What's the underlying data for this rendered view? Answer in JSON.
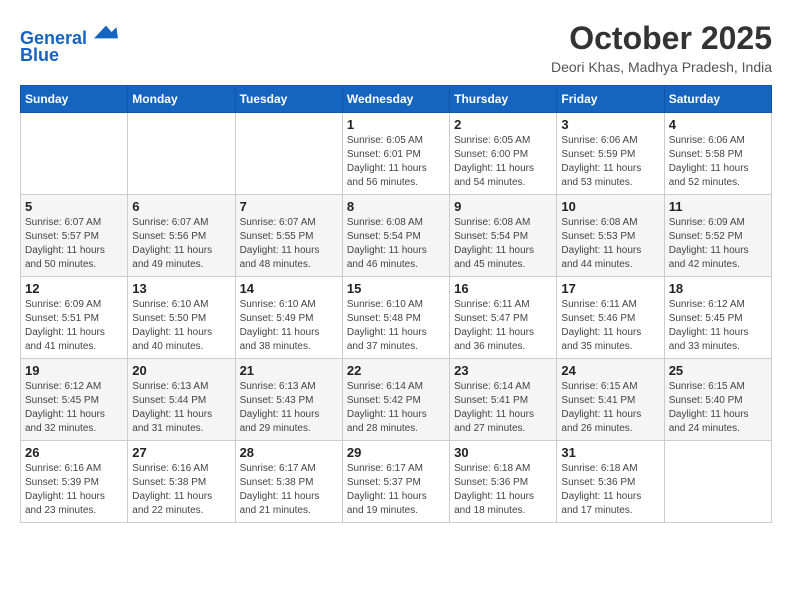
{
  "header": {
    "logo_line1": "General",
    "logo_line2": "Blue",
    "month": "October 2025",
    "location": "Deori Khas, Madhya Pradesh, India"
  },
  "weekdays": [
    "Sunday",
    "Monday",
    "Tuesday",
    "Wednesday",
    "Thursday",
    "Friday",
    "Saturday"
  ],
  "weeks": [
    [
      {
        "day": "",
        "info": ""
      },
      {
        "day": "",
        "info": ""
      },
      {
        "day": "",
        "info": ""
      },
      {
        "day": "1",
        "info": "Sunrise: 6:05 AM\nSunset: 6:01 PM\nDaylight: 11 hours\nand 56 minutes."
      },
      {
        "day": "2",
        "info": "Sunrise: 6:05 AM\nSunset: 6:00 PM\nDaylight: 11 hours\nand 54 minutes."
      },
      {
        "day": "3",
        "info": "Sunrise: 6:06 AM\nSunset: 5:59 PM\nDaylight: 11 hours\nand 53 minutes."
      },
      {
        "day": "4",
        "info": "Sunrise: 6:06 AM\nSunset: 5:58 PM\nDaylight: 11 hours\nand 52 minutes."
      }
    ],
    [
      {
        "day": "5",
        "info": "Sunrise: 6:07 AM\nSunset: 5:57 PM\nDaylight: 11 hours\nand 50 minutes."
      },
      {
        "day": "6",
        "info": "Sunrise: 6:07 AM\nSunset: 5:56 PM\nDaylight: 11 hours\nand 49 minutes."
      },
      {
        "day": "7",
        "info": "Sunrise: 6:07 AM\nSunset: 5:55 PM\nDaylight: 11 hours\nand 48 minutes."
      },
      {
        "day": "8",
        "info": "Sunrise: 6:08 AM\nSunset: 5:54 PM\nDaylight: 11 hours\nand 46 minutes."
      },
      {
        "day": "9",
        "info": "Sunrise: 6:08 AM\nSunset: 5:54 PM\nDaylight: 11 hours\nand 45 minutes."
      },
      {
        "day": "10",
        "info": "Sunrise: 6:08 AM\nSunset: 5:53 PM\nDaylight: 11 hours\nand 44 minutes."
      },
      {
        "day": "11",
        "info": "Sunrise: 6:09 AM\nSunset: 5:52 PM\nDaylight: 11 hours\nand 42 minutes."
      }
    ],
    [
      {
        "day": "12",
        "info": "Sunrise: 6:09 AM\nSunset: 5:51 PM\nDaylight: 11 hours\nand 41 minutes."
      },
      {
        "day": "13",
        "info": "Sunrise: 6:10 AM\nSunset: 5:50 PM\nDaylight: 11 hours\nand 40 minutes."
      },
      {
        "day": "14",
        "info": "Sunrise: 6:10 AM\nSunset: 5:49 PM\nDaylight: 11 hours\nand 38 minutes."
      },
      {
        "day": "15",
        "info": "Sunrise: 6:10 AM\nSunset: 5:48 PM\nDaylight: 11 hours\nand 37 minutes."
      },
      {
        "day": "16",
        "info": "Sunrise: 6:11 AM\nSunset: 5:47 PM\nDaylight: 11 hours\nand 36 minutes."
      },
      {
        "day": "17",
        "info": "Sunrise: 6:11 AM\nSunset: 5:46 PM\nDaylight: 11 hours\nand 35 minutes."
      },
      {
        "day": "18",
        "info": "Sunrise: 6:12 AM\nSunset: 5:45 PM\nDaylight: 11 hours\nand 33 minutes."
      }
    ],
    [
      {
        "day": "19",
        "info": "Sunrise: 6:12 AM\nSunset: 5:45 PM\nDaylight: 11 hours\nand 32 minutes."
      },
      {
        "day": "20",
        "info": "Sunrise: 6:13 AM\nSunset: 5:44 PM\nDaylight: 11 hours\nand 31 minutes."
      },
      {
        "day": "21",
        "info": "Sunrise: 6:13 AM\nSunset: 5:43 PM\nDaylight: 11 hours\nand 29 minutes."
      },
      {
        "day": "22",
        "info": "Sunrise: 6:14 AM\nSunset: 5:42 PM\nDaylight: 11 hours\nand 28 minutes."
      },
      {
        "day": "23",
        "info": "Sunrise: 6:14 AM\nSunset: 5:41 PM\nDaylight: 11 hours\nand 27 minutes."
      },
      {
        "day": "24",
        "info": "Sunrise: 6:15 AM\nSunset: 5:41 PM\nDaylight: 11 hours\nand 26 minutes."
      },
      {
        "day": "25",
        "info": "Sunrise: 6:15 AM\nSunset: 5:40 PM\nDaylight: 11 hours\nand 24 minutes."
      }
    ],
    [
      {
        "day": "26",
        "info": "Sunrise: 6:16 AM\nSunset: 5:39 PM\nDaylight: 11 hours\nand 23 minutes."
      },
      {
        "day": "27",
        "info": "Sunrise: 6:16 AM\nSunset: 5:38 PM\nDaylight: 11 hours\nand 22 minutes."
      },
      {
        "day": "28",
        "info": "Sunrise: 6:17 AM\nSunset: 5:38 PM\nDaylight: 11 hours\nand 21 minutes."
      },
      {
        "day": "29",
        "info": "Sunrise: 6:17 AM\nSunset: 5:37 PM\nDaylight: 11 hours\nand 19 minutes."
      },
      {
        "day": "30",
        "info": "Sunrise: 6:18 AM\nSunset: 5:36 PM\nDaylight: 11 hours\nand 18 minutes."
      },
      {
        "day": "31",
        "info": "Sunrise: 6:18 AM\nSunset: 5:36 PM\nDaylight: 11 hours\nand 17 minutes."
      },
      {
        "day": "",
        "info": ""
      }
    ]
  ]
}
